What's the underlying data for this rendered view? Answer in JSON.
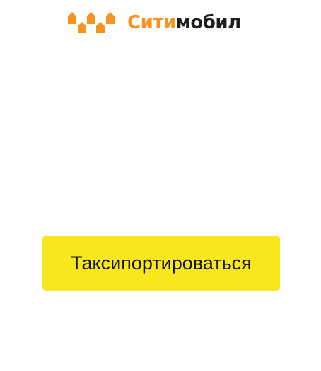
{
  "brand": {
    "name_part1": "Сити",
    "name_part2": "мобил",
    "logo_icon": "three-houses-icon",
    "colors": {
      "accent_orange": "#f7941d",
      "text_dark": "#1f1f1f"
    }
  },
  "main": {
    "cta_label": "Таксипортироваться",
    "cta_color": "#f8e71c"
  }
}
